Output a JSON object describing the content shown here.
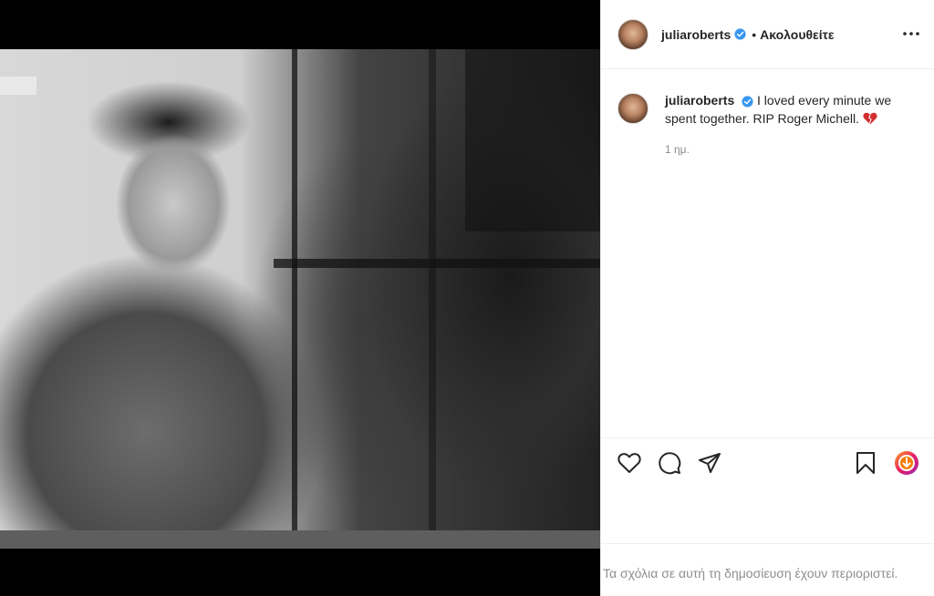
{
  "post": {
    "username": "juliaroberts",
    "follow_status": "Ακολουθείτε",
    "dot": "•",
    "caption": "I loved every minute we spent together. RIP Roger Michell.",
    "time_ago": "1 ημ.",
    "comments_restricted": "Τα σχόλια σε αυτή τη δημοσίευση έχουν περιοριστεί."
  },
  "icons": {
    "verified": "verified-badge-icon",
    "more": "more-options-icon",
    "like": "heart-icon",
    "comment": "comment-icon",
    "share": "paper-plane-icon",
    "save": "bookmark-icon",
    "emoji": "broken-heart-emoji"
  },
  "colors": {
    "verified_blue": "#3897f0",
    "text": "#262626",
    "muted": "#8e8e8e",
    "emoji_red": "#d32f2f"
  }
}
